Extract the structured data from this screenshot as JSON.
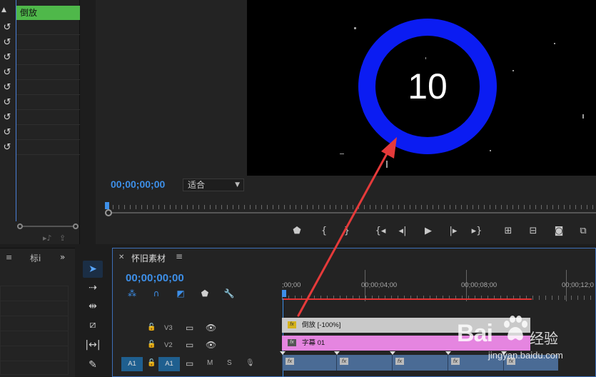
{
  "effect_controls": {
    "clip_name": "倒放"
  },
  "program_monitor": {
    "overlay_number": "10",
    "timecode": "00;00;00;00",
    "fit_label": "适合",
    "ring_color": "#0b1cf2"
  },
  "project_panel": {
    "tab_label": "标i",
    "more_label": "»"
  },
  "timeline": {
    "sequence_name": "怀旧素材",
    "timecode": "00;00;00;00",
    "ruler_labels": [
      ";00;00",
      "00;00;04;00",
      "00;00;08;00",
      "00;00;12;0"
    ],
    "tracks": {
      "v3": {
        "name": "V3",
        "clip_label": "倒放 [-100%]"
      },
      "v2": {
        "name": "V2",
        "clip_label": "字幕 01"
      },
      "a1": {
        "source": "A1",
        "name": "A1",
        "mute": "M",
        "solo": "S"
      }
    },
    "accent_color": "#3d8fe8",
    "inout_color": "#e33232"
  },
  "watermark": {
    "brand": "Bai",
    "brand_suffix": "经验",
    "url": "jingyan.baidu.com"
  }
}
